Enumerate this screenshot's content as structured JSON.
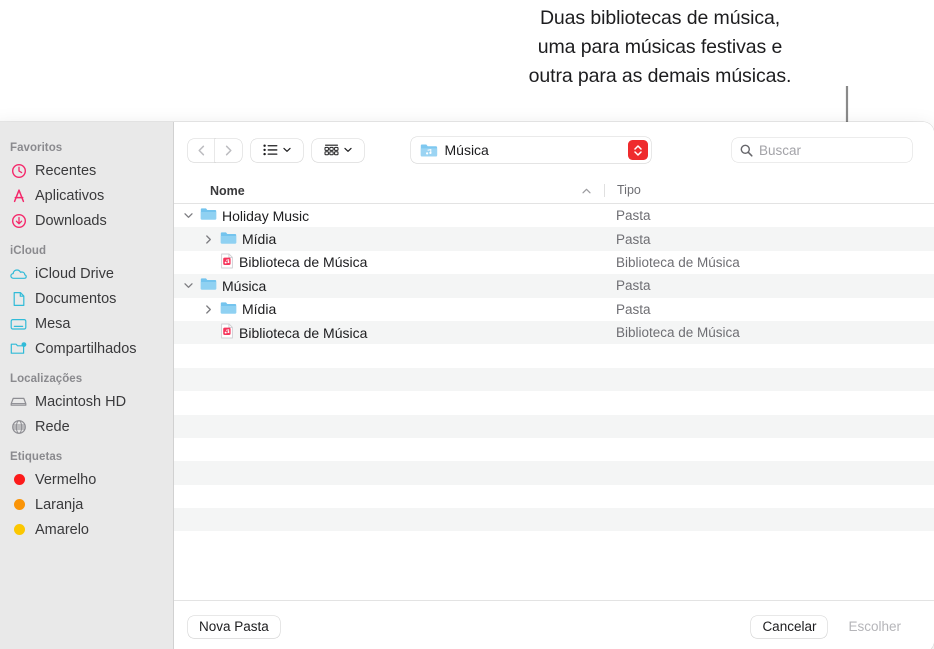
{
  "annotation": {
    "lines": [
      "Duas bibliotecas de música,",
      "uma para músicas festivas e",
      "outra para as demais músicas."
    ]
  },
  "sidebar": {
    "groups": [
      {
        "header": "Favoritos",
        "items": [
          {
            "label": "Recentes",
            "icon": "clock-icon",
            "color": "#f4296b"
          },
          {
            "label": "Aplicativos",
            "icon": "applications-icon",
            "color": "#f4296b"
          },
          {
            "label": "Downloads",
            "icon": "download-icon",
            "color": "#f4296b"
          }
        ]
      },
      {
        "header": "iCloud",
        "items": [
          {
            "label": "iCloud Drive",
            "icon": "cloud-icon",
            "color": "#31bbd8"
          },
          {
            "label": "Documentos",
            "icon": "document-icon",
            "color": "#31bbd8"
          },
          {
            "label": "Mesa",
            "icon": "desktop-icon",
            "color": "#31bbd8"
          }
        ]
      },
      {
        "header": "Localizações",
        "items": [
          {
            "label": "Compartilhados",
            "icon": "shared-folder-icon",
            "color": "#31bbd8",
            "above_header": true
          },
          {
            "label": "Macintosh HD",
            "icon": "harddisk-icon",
            "color": "#8e8e93"
          },
          {
            "label": "Rede",
            "icon": "globe-icon",
            "color": "#8e8e93"
          }
        ]
      },
      {
        "header": "Etiquetas",
        "items": [
          {
            "label": "Vermelho",
            "icon": "tag-dot-icon",
            "color": "#fc1b1b"
          },
          {
            "label": "Laranja",
            "icon": "tag-dot-icon",
            "color": "#fa9407"
          },
          {
            "label": "Amarelo",
            "icon": "tag-dot-icon",
            "color": "#fbc700"
          }
        ]
      }
    ]
  },
  "toolbar": {
    "back_label": "‹",
    "forward_label": "›",
    "view_mode": "list-view",
    "arrange_mode": "arrange-by",
    "path": {
      "label": "Música",
      "icon": "music-folder-icon"
    },
    "search": {
      "placeholder": "Buscar",
      "value": ""
    }
  },
  "columns": {
    "name": "Nome",
    "type": "Tipo",
    "sort": "ascending"
  },
  "rows": [
    {
      "name": "Holiday Music",
      "type": "Pasta",
      "icon": "folder-icon",
      "indent": 0,
      "disclosure": "expanded"
    },
    {
      "name": "Mídia",
      "type": "Pasta",
      "icon": "folder-icon",
      "indent": 1,
      "disclosure": "collapsed"
    },
    {
      "name": "Biblioteca de Música",
      "type": "Biblioteca de Música",
      "icon": "music-library-icon",
      "indent": 1,
      "disclosure": "none"
    },
    {
      "name": "Música",
      "type": "Pasta",
      "icon": "folder-icon",
      "indent": 0,
      "disclosure": "expanded"
    },
    {
      "name": "Mídia",
      "type": "Pasta",
      "icon": "folder-icon",
      "indent": 1,
      "disclosure": "collapsed"
    },
    {
      "name": "Biblioteca de Música",
      "type": "Biblioteca de Música",
      "icon": "music-library-icon",
      "indent": 1,
      "disclosure": "none"
    }
  ],
  "empty_row_count": 9,
  "footer": {
    "new_folder": "Nova Pasta",
    "cancel": "Cancelar",
    "choose": "Escolher",
    "choose_disabled": true
  }
}
